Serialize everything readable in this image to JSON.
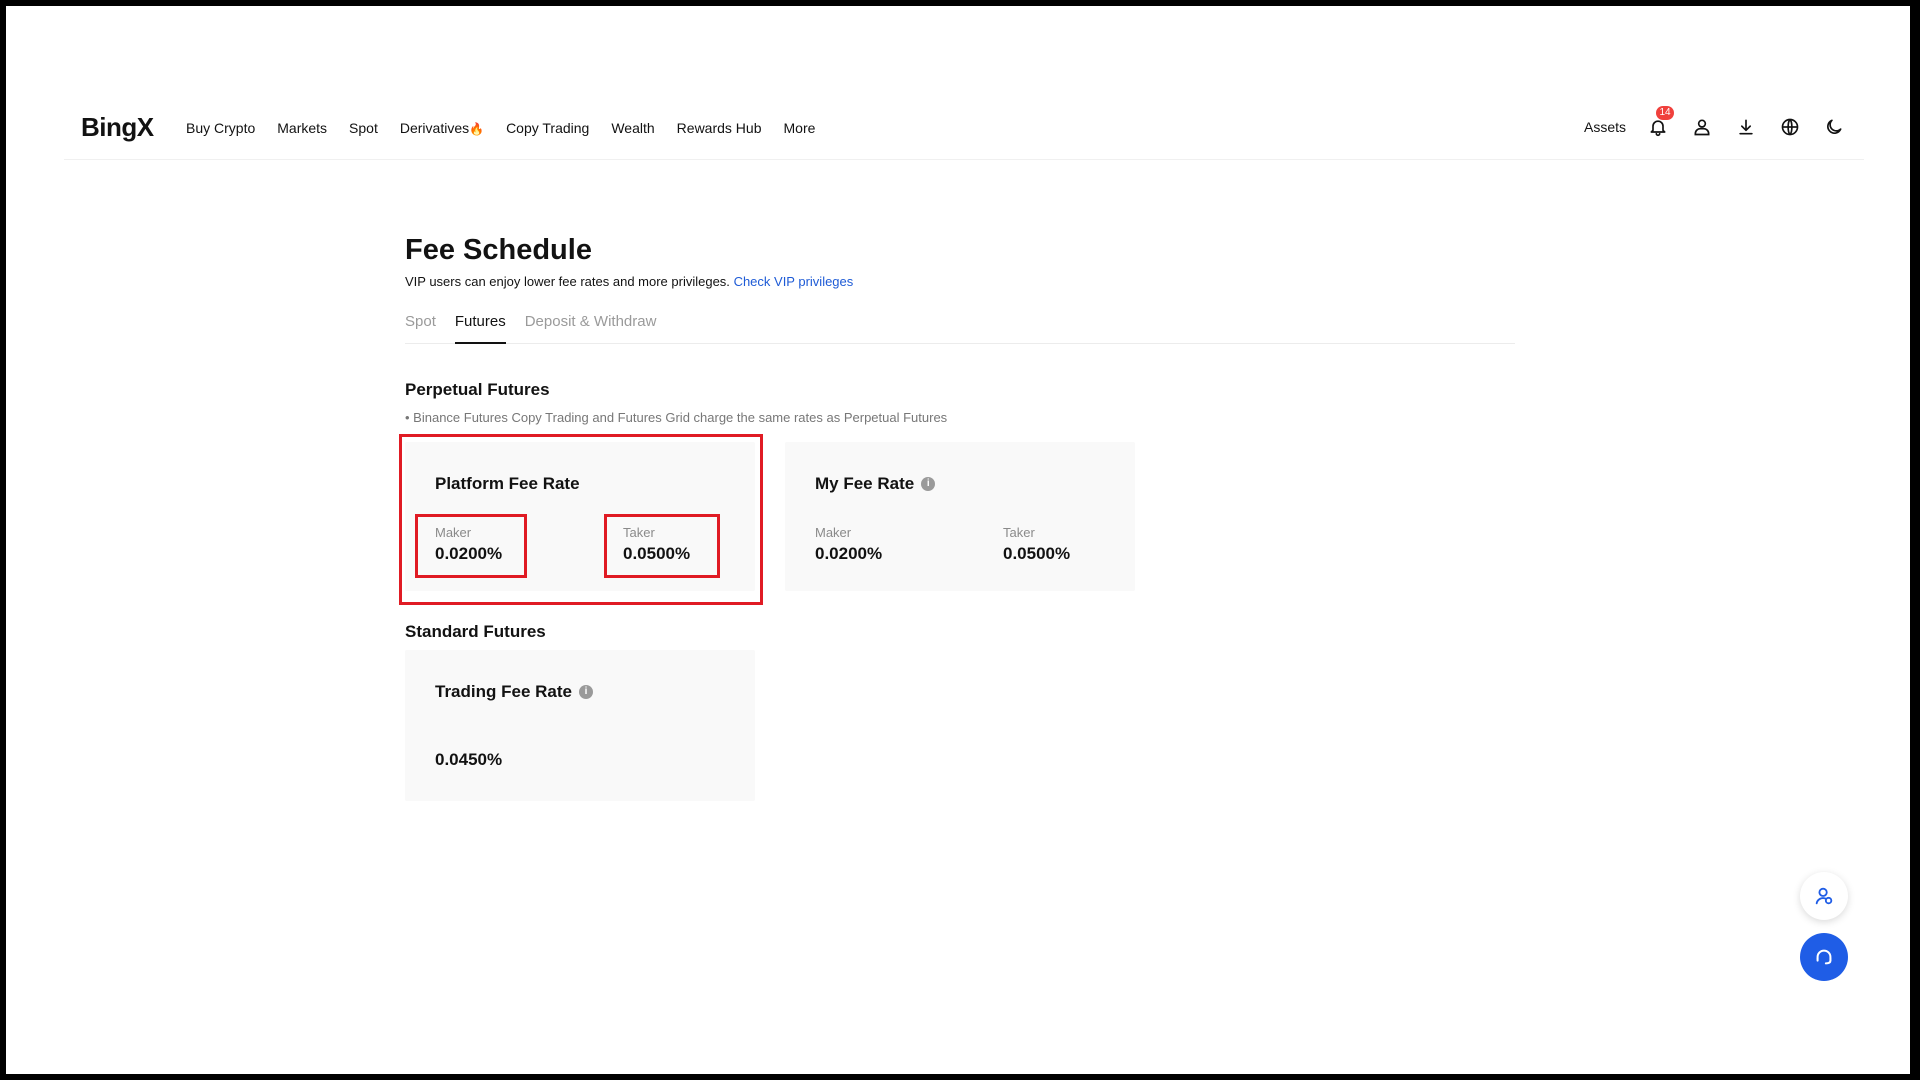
{
  "header": {
    "logo": "BingX",
    "nav": [
      {
        "label": "Buy Crypto"
      },
      {
        "label": "Markets"
      },
      {
        "label": "Spot"
      },
      {
        "label": "Derivatives"
      },
      {
        "label": "Copy Trading"
      },
      {
        "label": "Wealth"
      },
      {
        "label": "Rewards Hub"
      },
      {
        "label": "More"
      }
    ],
    "assets_label": "Assets",
    "notification_count": "14",
    "icons": [
      "bell-icon",
      "user-icon",
      "download-icon",
      "globe-icon",
      "moon-icon"
    ]
  },
  "page": {
    "title": "Fee Schedule",
    "subtitle": "VIP users can enjoy lower fee rates and more privileges.",
    "vip_link": "Check VIP privileges",
    "tabs": [
      {
        "label": "Spot",
        "active": false
      },
      {
        "label": "Futures",
        "active": true
      },
      {
        "label": "Deposit & Withdraw",
        "active": false
      }
    ]
  },
  "perpetual": {
    "title": "Perpetual Futures",
    "note": "Binance Futures Copy Trading and Futures Grid charge the same rates as Perpetual Futures",
    "platform": {
      "title": "Platform Fee Rate",
      "maker_label": "Maker",
      "maker_value": "0.0200%",
      "taker_label": "Taker",
      "taker_value": "0.0500%"
    },
    "my": {
      "title": "My Fee Rate",
      "maker_label": "Maker",
      "maker_value": "0.0200%",
      "taker_label": "Taker",
      "taker_value": "0.0500%"
    }
  },
  "standard": {
    "title": "Standard Futures",
    "card_title": "Trading Fee Rate",
    "value": "0.0450%"
  },
  "colors": {
    "link": "#1e5bd6",
    "highlight": "#e01b24",
    "badge": "#f0403c",
    "support_button": "#1f5de6"
  }
}
